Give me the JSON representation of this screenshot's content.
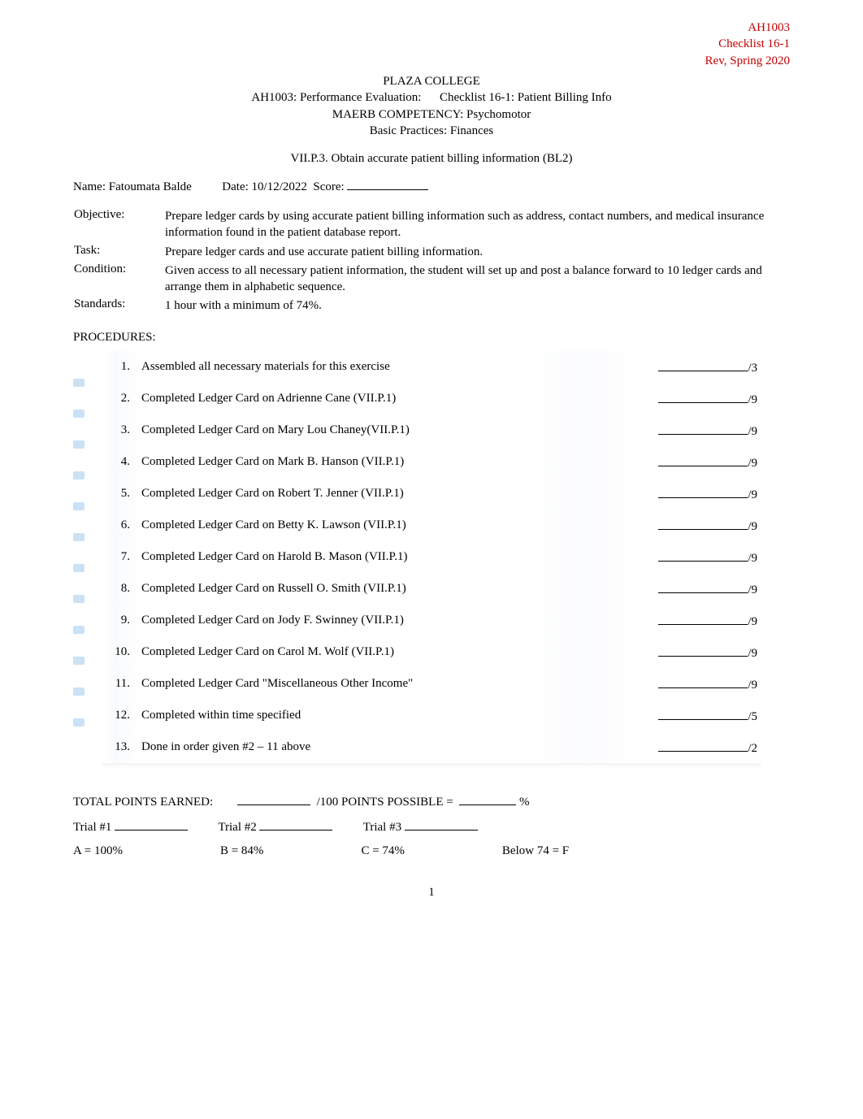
{
  "header_right": {
    "code": "AH1003",
    "checklist": "Checklist 16-1",
    "rev": "Rev, Spring 2020"
  },
  "title": {
    "school": "PLAZA COLLEGE",
    "course_line_prefix": "AH1003:   Performance Evaluation:",
    "course_line_suffix": "Checklist 16-1: Patient Billing Info",
    "maerb": "MAERB COMPETENCY:    Psychomotor",
    "basic": "Basic Practices: Finances"
  },
  "objective_code": "VII.P.3. Obtain accurate patient billing information (BL2)",
  "name_label": "Name:",
  "name_value": "Fatoumata Balde",
  "date_label": "Date:",
  "date_value": "10/12/2022",
  "score_label": "Score:",
  "defs": {
    "objective_label": "Objective:",
    "objective_text": "Prepare ledger cards by using accurate patient billing information such as address, contact numbers, and medical insurance information found in the patient database report.",
    "task_label": "Task:",
    "task_text": "Prepare ledger cards and use accurate patient billing information.",
    "condition_label": "Condition:",
    "condition_text": "Given access to all necessary patient information, the student will set up and post a balance forward to 10 ledger cards and arrange them in alphabetic sequence.",
    "standards_label": "Standards:",
    "standards_text": "1 hour with a minimum of 74%."
  },
  "procedures_heading": "PROCEDURES:",
  "procedures": [
    {
      "n": "1.",
      "text": "Assembled all necessary materials for this exercise",
      "max": "/3"
    },
    {
      "n": "2.",
      "text": "Completed Ledger Card on Adrienne Cane (VII.P.1)",
      "max": "/9"
    },
    {
      "n": "3.",
      "text": "Completed Ledger Card on Mary Lou Chaney(VII.P.1)",
      "max": "/9"
    },
    {
      "n": "4.",
      "text": "Completed Ledger Card on Mark B. Hanson (VII.P.1)",
      "max": "/9"
    },
    {
      "n": "5.",
      "text": "Completed Ledger Card on Robert T. Jenner (VII.P.1)",
      "max": "/9"
    },
    {
      "n": "6.",
      "text": "Completed Ledger Card on Betty K. Lawson (VII.P.1)",
      "max": "/9"
    },
    {
      "n": "7.",
      "text": "Completed Ledger Card on Harold B. Mason (VII.P.1)",
      "max": "/9"
    },
    {
      "n": "8.",
      "text": "Completed Ledger Card on Russell O. Smith (VII.P.1)",
      "max": "/9"
    },
    {
      "n": "9.",
      "text": "Completed Ledger Card on Jody F. Swinney (VII.P.1)",
      "max": "/9"
    },
    {
      "n": "10.",
      "text": "Completed Ledger Card on Carol M. Wolf (VII.P.1)",
      "max": "/9"
    },
    {
      "n": "11.",
      "text": "Completed Ledger Card \"Miscellaneous Other Income\"",
      "max": "/9"
    },
    {
      "n": "12.",
      "text": "Completed within time specified",
      "max": "/5"
    },
    {
      "n": "13.",
      "text": "Done in order given #2 – 11 above",
      "max": "/2"
    }
  ],
  "totals": {
    "earned_label": "TOTAL POINTS EARNED:",
    "possible_label": "/100 POINTS POSSIBLE =",
    "percent_label": "%",
    "trial1": "Trial #1",
    "trial2": "Trial #2",
    "trial3": "Trial #3"
  },
  "grades": {
    "a": "A = 100%",
    "b": "B = 84%",
    "c": "C = 74%",
    "f": "Below 74 = F"
  },
  "page_number": "1"
}
